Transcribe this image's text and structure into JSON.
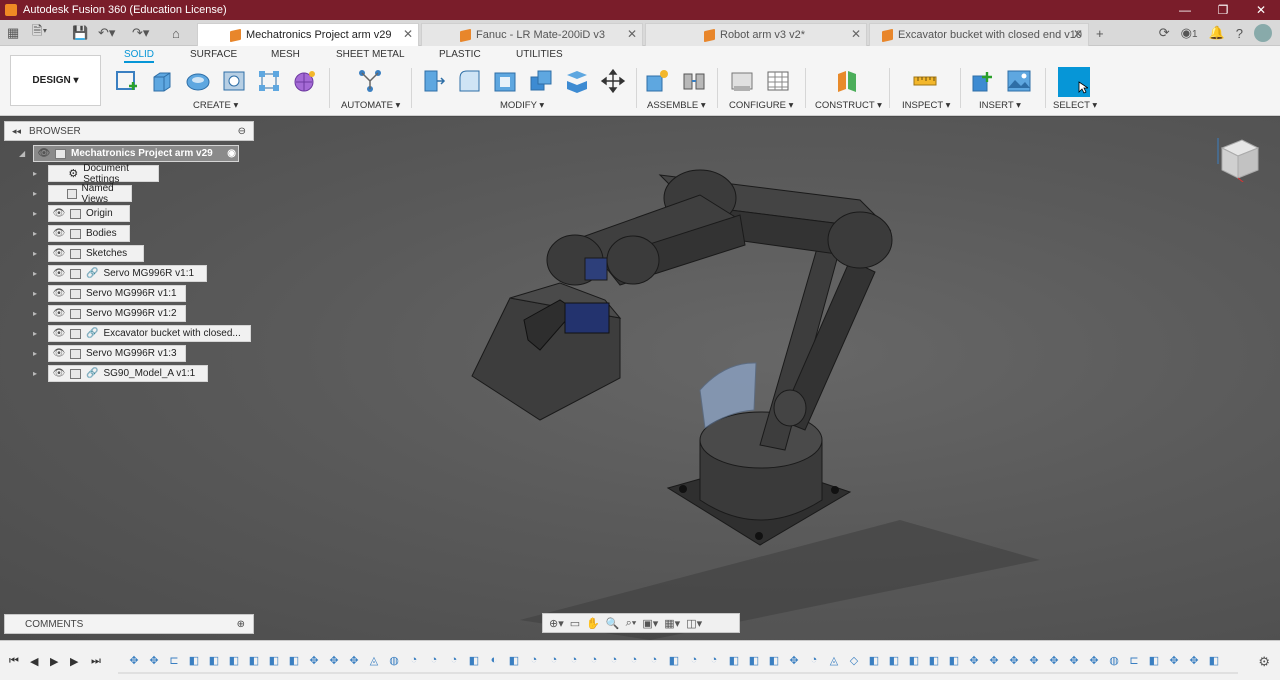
{
  "window": {
    "title": "Autodesk Fusion 360 (Education License)",
    "controls": [
      "—",
      "❐",
      "✕"
    ]
  },
  "tabs": [
    {
      "label": "Mechatronics Project arm v29",
      "active": true
    },
    {
      "label": "Fanuc - LR Mate-200iD v3",
      "active": false
    },
    {
      "label": "Robot arm v3 v2*",
      "active": false
    },
    {
      "label": "Excavator bucket with closed end v10",
      "active": false
    }
  ],
  "header_right": {
    "job_count": "1"
  },
  "toolbar": {
    "workspace": "DESIGN ▾",
    "mode_tabs": [
      "SOLID",
      "SURFACE",
      "MESH",
      "SHEET METAL",
      "PLASTIC",
      "UTILITIES"
    ],
    "groups": [
      "CREATE ▾",
      "AUTOMATE ▾",
      "MODIFY ▾",
      "ASSEMBLE ▾",
      "CONFIGURE ▾",
      "CONSTRUCT ▾",
      "INSPECT ▾",
      "INSERT ▾",
      "SELECT ▾"
    ]
  },
  "browser": {
    "title": "BROWSER",
    "root": "Mechatronics Project arm v29",
    "items": [
      {
        "label": "Document Settings",
        "icon": "gear-icon",
        "eye": false,
        "link": false
      },
      {
        "label": "Named Views",
        "icon": "folder-icon",
        "eye": false,
        "link": false
      },
      {
        "label": "Origin",
        "icon": "folder-icon",
        "eye": true,
        "link": false
      },
      {
        "label": "Bodies",
        "icon": "folder-icon",
        "eye": true,
        "link": false
      },
      {
        "label": "Sketches",
        "icon": "folder-icon",
        "eye": true,
        "link": false
      },
      {
        "label": "Servo MG996R v1:1",
        "icon": "component-icon",
        "eye": true,
        "link": true
      },
      {
        "label": "Servo MG996R v1:1",
        "icon": "component-icon",
        "eye": true,
        "link": false
      },
      {
        "label": "Servo MG996R v1:2",
        "icon": "component-icon",
        "eye": true,
        "link": false
      },
      {
        "label": "Excavator bucket with closed...",
        "icon": "assembly-icon",
        "eye": true,
        "link": true
      },
      {
        "label": "Servo MG996R v1:3",
        "icon": "component-icon",
        "eye": true,
        "link": false
      },
      {
        "label": "SG90_Model_A v1:1",
        "icon": "component-icon",
        "eye": true,
        "link": true
      }
    ]
  },
  "comments": {
    "title": "COMMENTS"
  },
  "colors": {
    "titlebar": "#7a1d2a",
    "accent": "#0696d7",
    "feature": "#3a7fc1"
  }
}
